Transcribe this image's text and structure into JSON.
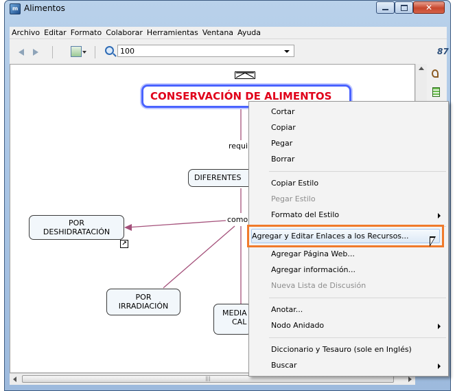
{
  "window": {
    "title": "Alimentos"
  },
  "menubar": [
    "Archivo",
    "Editar",
    "Formato",
    "Colaborar",
    "Herramientas",
    "Ventana",
    "Ayuda"
  ],
  "toolbar": {
    "zoom_value": "100"
  },
  "concept_map": {
    "title_node": "CONSERVACIÓN DE ALIMENTOS",
    "nodes": {
      "diferentes": "DIFERENTES",
      "deshidratacion_1": "POR",
      "deshidratacion_2": "DESHIDRATACIÓN",
      "irradiacion_1": "POR",
      "irradiacion_2": "IRRADIACIÓN",
      "mediante_1": "MEDIA",
      "mediante_2": "CAL"
    },
    "links": {
      "requiere": "requi",
      "como": "como"
    }
  },
  "context_menu": [
    {
      "label": "Cortar",
      "enabled": true,
      "submenu": false
    },
    {
      "label": "Copiar",
      "enabled": true,
      "submenu": false
    },
    {
      "label": "Pegar",
      "enabled": true,
      "submenu": false
    },
    {
      "label": "Borrar",
      "enabled": true,
      "submenu": false
    },
    {
      "label": "Copiar Estilo",
      "enabled": true,
      "submenu": false
    },
    {
      "label": "Pegar Estilo",
      "enabled": false,
      "submenu": false
    },
    {
      "label": "Formato del Estilo",
      "enabled": true,
      "submenu": true
    },
    {
      "label": "Agregar y Editar Enlaces a los Recursos...",
      "enabled": true,
      "submenu": false,
      "highlighted": true
    },
    {
      "label": "Agregar Página Web...",
      "enabled": true,
      "submenu": false
    },
    {
      "label": "Agregar información...",
      "enabled": true,
      "submenu": false
    },
    {
      "label": "Nueva Lista de Discusión",
      "enabled": false,
      "submenu": false
    },
    {
      "label": "Anotar...",
      "enabled": true,
      "submenu": false
    },
    {
      "label": "Nodo Anidado",
      "enabled": true,
      "submenu": true
    },
    {
      "label": "Diccionario y Tesauro (sole en Inglés)",
      "enabled": true,
      "submenu": false
    },
    {
      "label": "Buscar",
      "enabled": true,
      "submenu": true
    }
  ],
  "colors": {
    "title_text": "#e0001a",
    "title_border": "#4a63ff",
    "link_line": "#a4507a",
    "highlight_border": "#f07a2a"
  },
  "icons": [
    "app-icon",
    "back-arrow-icon",
    "forward-arrow-icon",
    "view-icon",
    "zoom-icon",
    "collaboration-icon",
    "resource-icon",
    "document-icon",
    "link-arrow-icon",
    "collapse-icon",
    "mouse-cursor-icon"
  ]
}
